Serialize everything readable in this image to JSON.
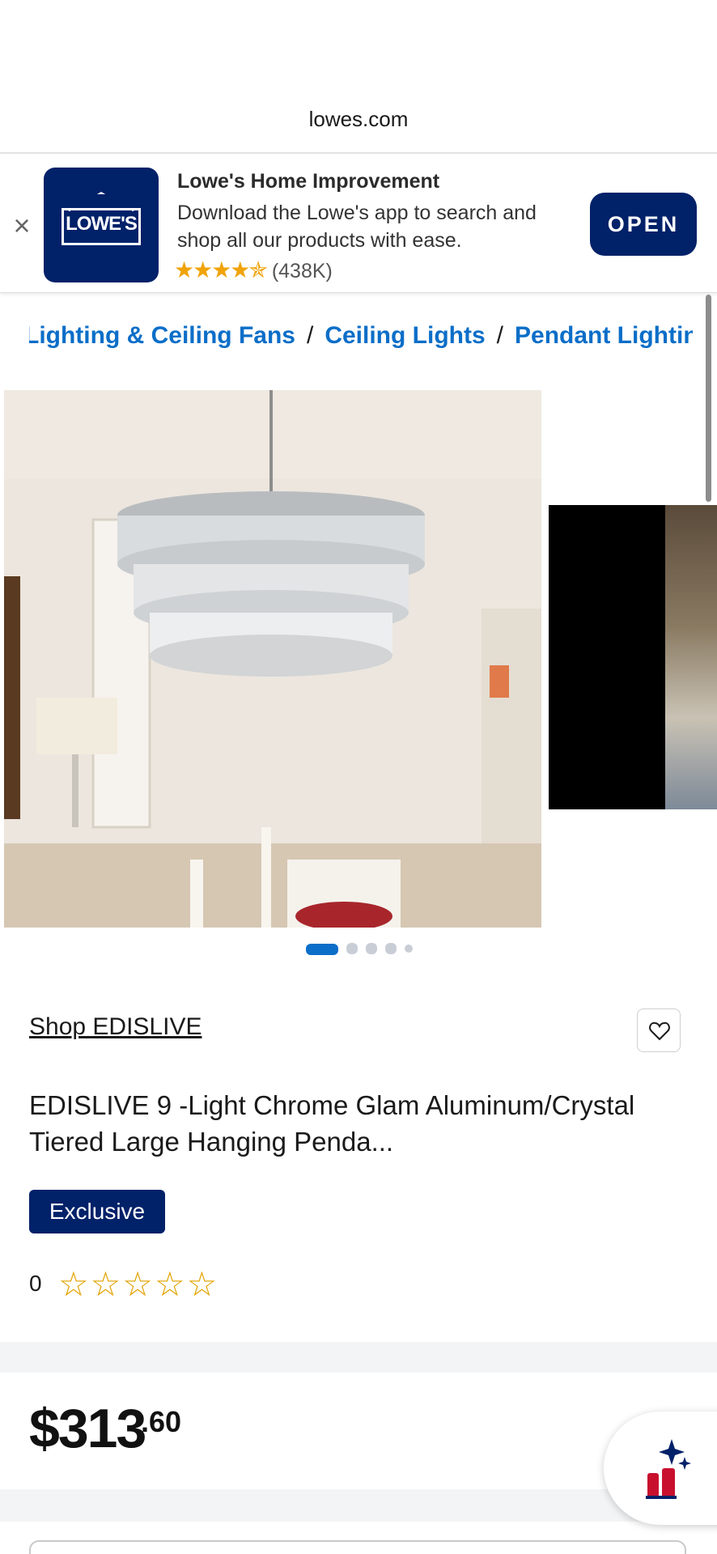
{
  "browser": {
    "url": "lowes.com"
  },
  "app_banner": {
    "close_label": "×",
    "logo_text": "LOWE'S",
    "title": "Lowe's Home Improvement",
    "description": "Download the Lowe's app to search and shop all our products with ease.",
    "rating_stars": "★★★★✯",
    "rating_count": "(438K)",
    "open_label": "OPEN"
  },
  "breadcrumb": {
    "items": [
      "Lighting & Ceiling Fans",
      "Ceiling Lights",
      "Pendant Lighting"
    ],
    "separator": "/"
  },
  "gallery": {
    "image_count": 5,
    "active_index": 0,
    "active_color": "#0b6ec8",
    "inactive_color": "#c9ced6"
  },
  "product": {
    "shop_link": "Shop EDISLIVE",
    "title": "EDISLIVE 9 -Light Chrome Glam Aluminum/Crystal Tiered Large Hanging Penda...",
    "badge": "Exclusive",
    "rating_count": "0",
    "rating_stars": "☆☆☆☆☆"
  },
  "price": {
    "dollars": "$313",
    "cents": ".60"
  },
  "colors": {
    "brand_navy": "#012169",
    "link_blue": "#0b6ec8",
    "star_gold": "#e2a300"
  },
  "icons": {
    "favorite": "heart-icon",
    "assistant": "ai-assistant-icon",
    "close": "close-icon"
  }
}
